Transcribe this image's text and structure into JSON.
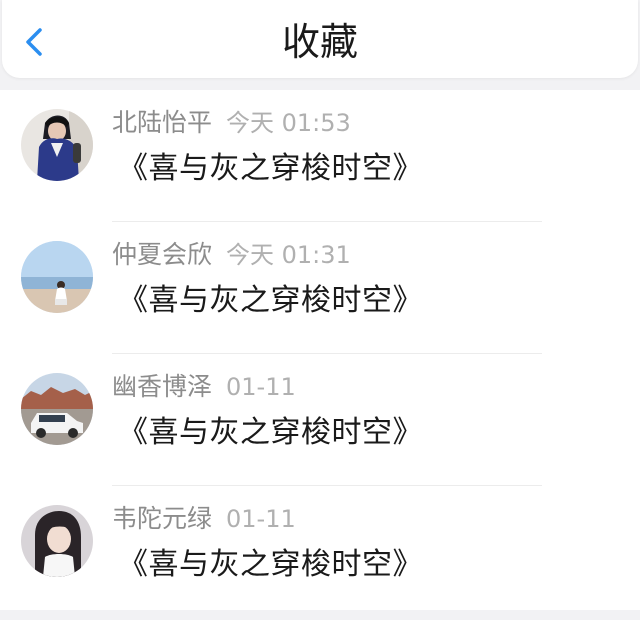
{
  "header": {
    "title": "收藏",
    "back_icon": "chevron-left-icon",
    "accent_color": "#2b8ef0"
  },
  "favorites": [
    {
      "user_name": "北陆怡平",
      "time": "今天 01:53",
      "title": "《喜与灰之穿梭时空》",
      "avatar": "avatar-person-dark-outfit"
    },
    {
      "user_name": "仲夏会欣",
      "time": "今天 01:31",
      "title": "《喜与灰之穿梭时空》",
      "avatar": "avatar-person-at-beach"
    },
    {
      "user_name": "幽香博泽",
      "time": "01-11",
      "title": "《喜与灰之穿梭时空》",
      "avatar": "avatar-white-suv"
    },
    {
      "user_name": "韦陀元绿",
      "time": "01-11",
      "title": "《喜与灰之穿梭时空》",
      "avatar": "avatar-girl-portrait"
    }
  ]
}
